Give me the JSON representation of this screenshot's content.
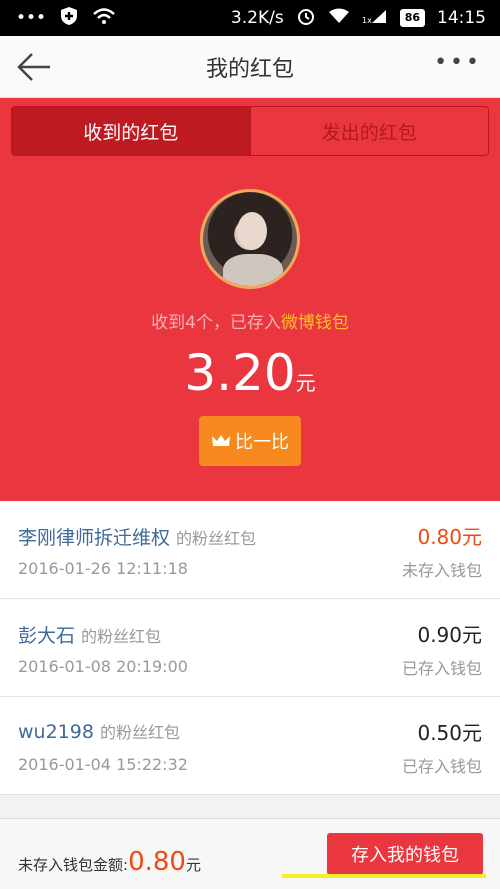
{
  "statusbar": {
    "speed": "3.2K/s",
    "battery": "86",
    "time": "14:15",
    "network": "1x"
  },
  "navbar": {
    "title": "我的红包",
    "more": "•••"
  },
  "tabs": [
    {
      "label": "收到的红包"
    },
    {
      "label": "发出的红包"
    }
  ],
  "hero": {
    "recv_prefix": "收到4个，已存入",
    "recv_link": "微博钱包",
    "amount": "3.20",
    "unit": "元",
    "compare_label": "比一比"
  },
  "items": [
    {
      "name": "李刚律师拆迁维权",
      "tag": "的粉丝红包",
      "time": "2016-01-26 12:11:18",
      "value": "0.80元",
      "state": "未存入钱包"
    },
    {
      "name": "彭大石",
      "tag": "的粉丝红包",
      "time": "2016-01-08 20:19:00",
      "value": "0.90元",
      "state": "已存入钱包"
    },
    {
      "name": "wu2198",
      "tag": "的粉丝红包",
      "time": "2016-01-04 15:22:32",
      "value": "0.50元",
      "state": "已存入钱包"
    }
  ],
  "footer": {
    "label": "未存入钱包金额:",
    "amount": "0.80",
    "unit": "元",
    "button": "存入我的钱包"
  },
  "colors": {
    "brand_red": "#e9363f",
    "orange": "#f7891e",
    "link_blue": "#3f6a9a",
    "alert": "#f04a12"
  }
}
